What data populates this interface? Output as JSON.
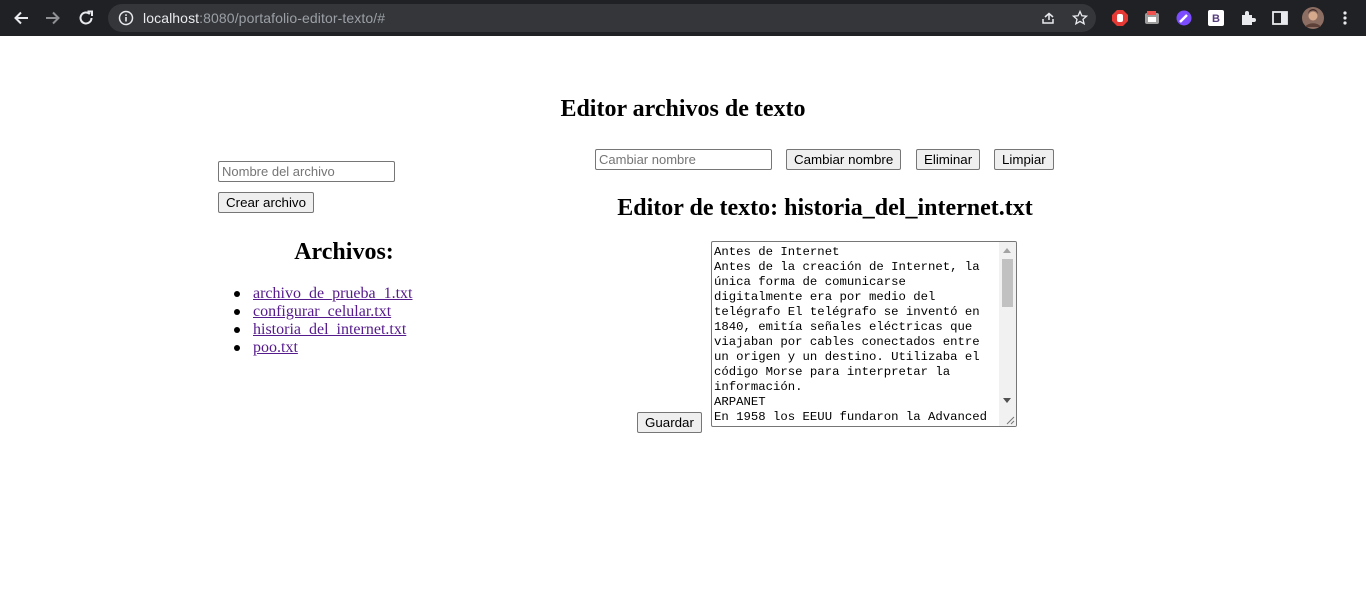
{
  "browser": {
    "url_host": "localhost",
    "url_rest": ":8080/portafolio-editor-texto/#"
  },
  "page": {
    "title": "Editor archivos de texto"
  },
  "create": {
    "filename_placeholder": "Nombre del archivo",
    "create_label": "Crear archivo"
  },
  "files": {
    "heading": "Archivos:",
    "items": [
      "archivo_de_prueba_1.txt",
      "configurar_celular.txt",
      "historia_del_internet.txt",
      "poo.txt"
    ]
  },
  "toolbar": {
    "rename_placeholder": "Cambiar nombre",
    "rename_label": "Cambiar nombre",
    "delete_label": "Eliminar",
    "clear_label": "Limpiar"
  },
  "editor": {
    "heading": "Editor de texto: historia_del_internet.txt",
    "save_label": "Guardar",
    "content": "Antes de Internet\nAntes de la creación de Internet, la única forma de comunicarse digitalmente era por medio del telégrafo El telégrafo se inventó en 1840, emitía señales eléctricas que viajaban por cables conectados entre un origen y un destino. Utilizaba el código Morse para interpretar la información.\nARPANET\nEn 1958 los EEUU fundaron la Advanced"
  },
  "colors": {
    "link_visited": "#551a8b",
    "chrome_bg": "#202124",
    "button_bg": "#efefef"
  }
}
